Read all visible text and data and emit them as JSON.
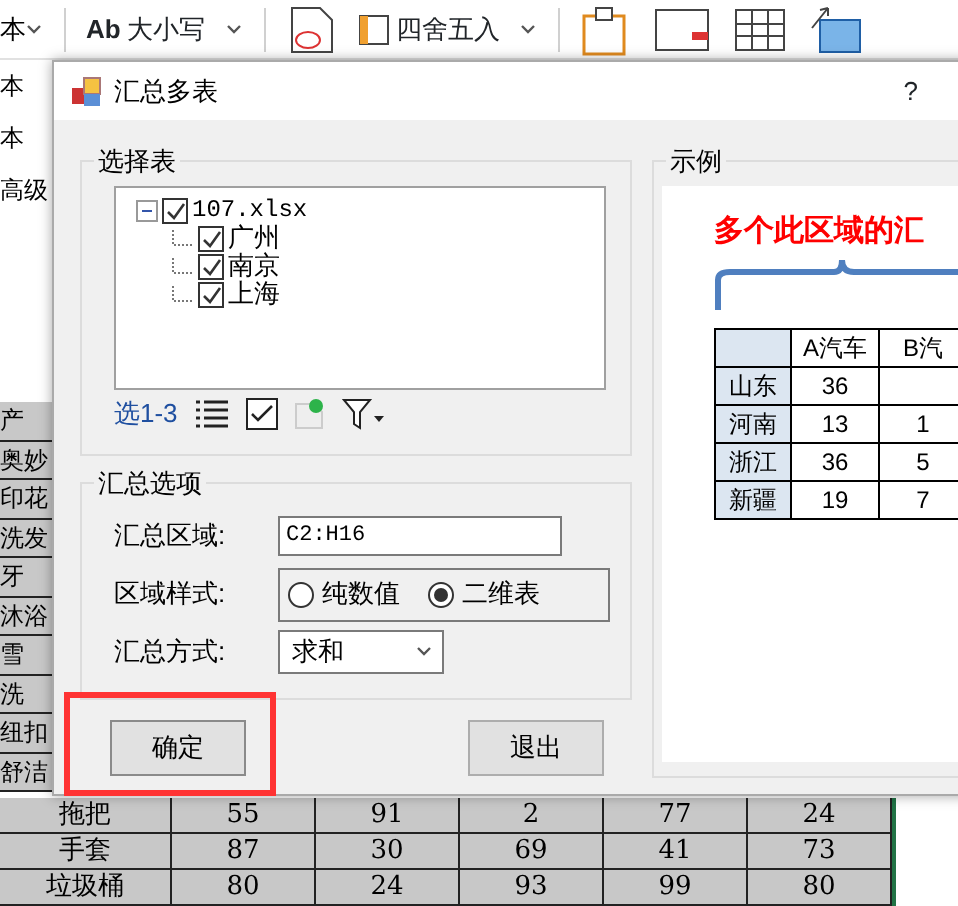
{
  "excel": {
    "ribbon": {
      "font_rows": [
        "本",
        "本",
        "本"
      ],
      "case_label": "Ab",
      "case_text": "大小写",
      "round_text": "四舍五入",
      "advanced_text": "高级"
    },
    "left_cells": [
      "产",
      "奥妙",
      "印花",
      "洗发",
      "牙",
      "沐浴",
      "雪",
      "洗",
      "纽扣",
      "舒洁"
    ],
    "rows": [
      [
        "拖把",
        "55",
        "91",
        "2",
        "77",
        "24"
      ],
      [
        "手套",
        "87",
        "30",
        "69",
        "41",
        "73"
      ],
      [
        "垃圾桶",
        "80",
        "24",
        "93",
        "99",
        "80"
      ]
    ]
  },
  "dialog": {
    "title": "汇总多表",
    "help": "?",
    "select_group": {
      "title": "选择表",
      "tree": {
        "label": "107.xlsx",
        "checked": true,
        "expanded": true,
        "children": [
          {
            "label": "广州",
            "checked": true
          },
          {
            "label": "南京",
            "checked": true
          },
          {
            "label": "上海",
            "checked": true
          }
        ]
      },
      "range_label": "选1-3"
    },
    "options_group": {
      "title": "汇总选项",
      "area_label": "汇总区域:",
      "area_value": "C2:H16",
      "style_label": "区域样式:",
      "style_options": [
        {
          "label": "纯数值",
          "selected": false
        },
        {
          "label": "二维表",
          "selected": true
        }
      ],
      "method_label": "汇总方式:",
      "method_value": "求和"
    },
    "buttons": [
      {
        "label": "确定",
        "highlighted": true
      },
      {
        "label": "退出",
        "highlighted": false
      }
    ],
    "example": {
      "title": "示例",
      "caption": "多个此区域的汇",
      "table": {
        "columns": [
          "",
          "A汽车",
          "B汽"
        ],
        "rows": [
          [
            "山东",
            "36",
            ""
          ],
          [
            "河南",
            "13",
            "1"
          ],
          [
            "浙江",
            "36",
            "5"
          ],
          [
            "新疆",
            "19",
            "7"
          ]
        ]
      }
    }
  }
}
